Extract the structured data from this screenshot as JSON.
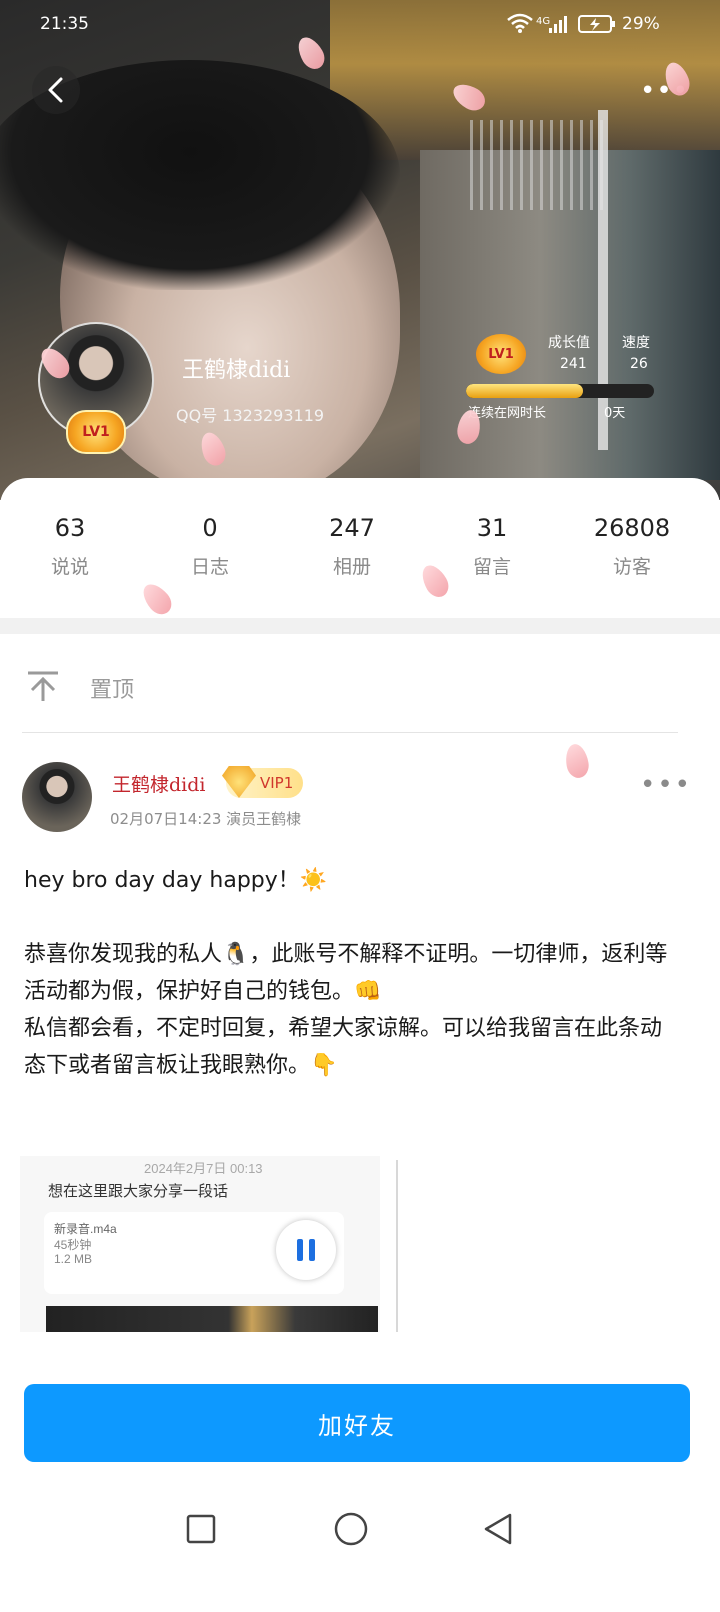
{
  "status_bar": {
    "time": "21:35",
    "network": "4G",
    "battery": "29%"
  },
  "profile": {
    "name": "王鹤棣didi",
    "qq_number": "QQ号 1323293119",
    "level_badge": "LV1"
  },
  "growth": {
    "badge": "LV1",
    "growth_label": "成长值",
    "growth_value": "241",
    "speed_label": "速度",
    "speed_value": "26",
    "progress_fraction": 0.62,
    "online_label": "连续在网时长",
    "online_value": "0天"
  },
  "stats": [
    {
      "value": "63",
      "label": "说说"
    },
    {
      "value": "0",
      "label": "日志"
    },
    {
      "value": "247",
      "label": "相册"
    },
    {
      "value": "31",
      "label": "留言"
    },
    {
      "value": "26808",
      "label": "访客"
    }
  ],
  "pinned": {
    "label": "置顶"
  },
  "post": {
    "author": "王鹤棣didi",
    "vip": "VIP1",
    "meta": "02月07日14:23  演员王鹤棣",
    "text": "hey bro day day happy！☀️\n\n恭喜你发现我的私人🐧，此账号不解释不证明。一切律师，返利等活动都为假，保护好自己的钱包。👊\n私信都会看，不定时回复，希望大家谅解。可以给我留言在此条动态下或者留言板让我眼熟你。👇",
    "attachment": {
      "date": "2024年2月7日 00:13",
      "caption": "想在这里跟大家分享一段话",
      "file_name": "新录音.m4a",
      "duration": "45秒钟",
      "size": "1.2 MB"
    }
  },
  "actions": {
    "add_friend": "加好友"
  },
  "icons": {
    "back": "back-arrow-icon",
    "more": "more-dots-icon",
    "pin": "pin-top-icon",
    "pause": "pause-icon",
    "nav_recent": "square-icon",
    "nav_home": "circle-icon",
    "nav_back": "triangle-icon"
  },
  "colors": {
    "accent": "#0d99ff",
    "author_name": "#c3262d"
  }
}
